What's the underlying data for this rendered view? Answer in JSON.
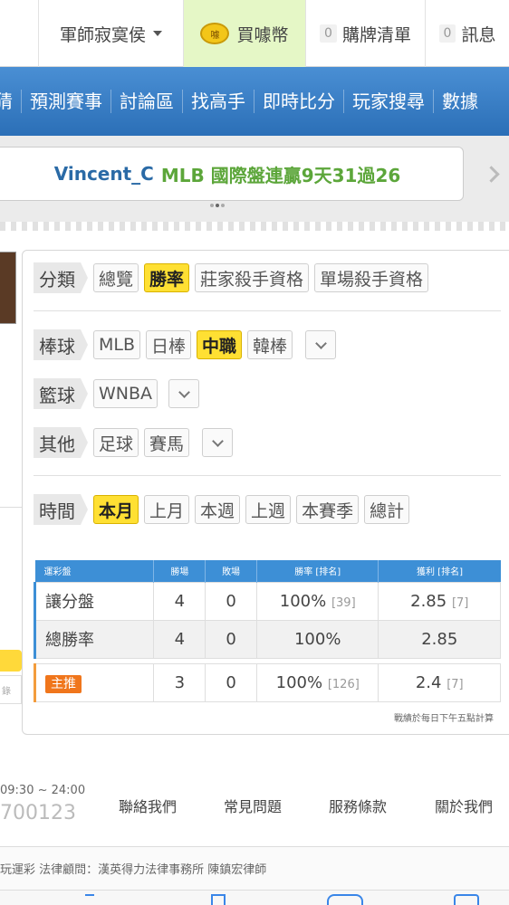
{
  "topbar": {
    "user": "軍師寂寞侯",
    "coin_label": "買噱幣",
    "coin_badge": "噱",
    "cart_count": "0",
    "cart_label": "購牌清單",
    "msg_count": "0",
    "msg_label": "訊息"
  },
  "nav": [
    "猜",
    "預測賽事",
    "討論區",
    "找高手",
    "即時比分",
    "玩家搜尋",
    "數據"
  ],
  "banner": {
    "name": "Vincent_C",
    "text": "MLB 國際盤連贏9天31過26"
  },
  "filters": {
    "category": {
      "label": "分類",
      "options": [
        "總覽",
        "勝率",
        "莊家殺手資格",
        "單場殺手資格"
      ]
    },
    "baseball": {
      "label": "棒球",
      "options": [
        "MLB",
        "日棒",
        "中職",
        "韓棒"
      ]
    },
    "basketball": {
      "label": "籃球",
      "options": [
        "WNBA"
      ]
    },
    "other": {
      "label": "其他",
      "options": [
        "足球",
        "賽馬"
      ]
    },
    "time": {
      "label": "時間",
      "options": [
        "本月",
        "上月",
        "本週",
        "上週",
        "本賽季",
        "總計"
      ]
    }
  },
  "table": {
    "headers": [
      "運彩盤",
      "勝場",
      "敗場",
      "勝率 [排名]",
      "獲利 [排名]"
    ],
    "rows": [
      {
        "type": "讓分盤",
        "win": "4",
        "lose": "0",
        "rate": "100%",
        "rate_rank": "[39]",
        "profit": "2.85",
        "profit_rank": "[7]"
      },
      {
        "type": "總勝率",
        "win": "4",
        "lose": "0",
        "rate": "100%",
        "rate_rank": "",
        "profit": "2.85",
        "profit_rank": ""
      }
    ],
    "featured": {
      "badge": "主推",
      "win": "3",
      "lose": "0",
      "rate": "100%",
      "rate_rank": "[126]",
      "profit": "2.4",
      "profit_rank": "[7]"
    },
    "note": "戰績於每日下午五點計算"
  },
  "footer": {
    "hours": "09:30 ~ 24:00",
    "phone": "700123",
    "links": [
      "聯絡我們",
      "常見問題",
      "服務條款",
      "關於我們"
    ],
    "legal": "玩運彩 法律顧問：漢英得力法律事務所 陳鎮宏律師",
    "stub_text": "錄"
  },
  "colors": {
    "nav_blue": "#2b6fb7",
    "active_chip": "#ffe033",
    "banner_green": "#5ca63a",
    "table_header": "#3d8fd6",
    "hot_badge": "#f0761c"
  }
}
